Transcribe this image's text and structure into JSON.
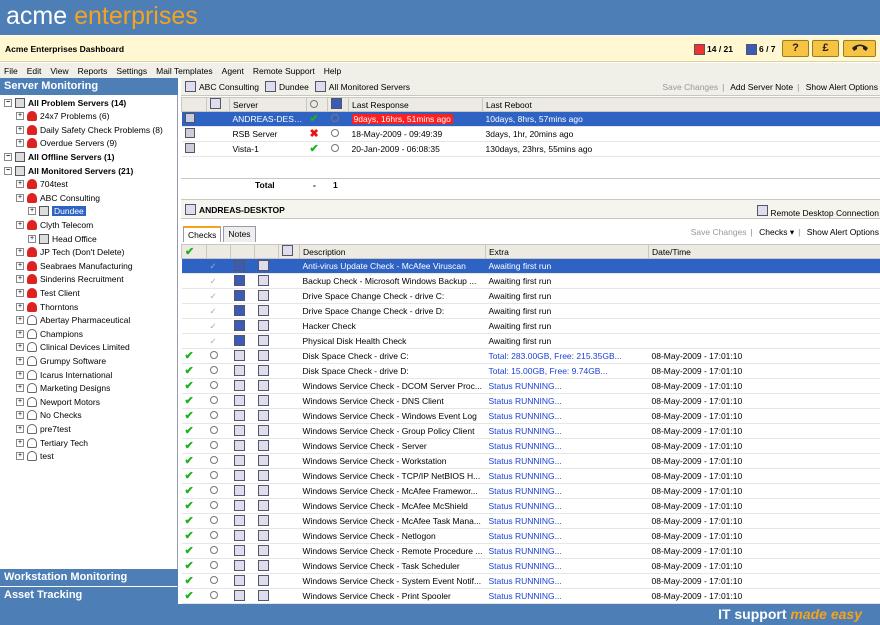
{
  "brand": {
    "part1": "acme",
    "part2": "enterprises"
  },
  "dashboard": {
    "title": "Acme Enterprises Dashboard",
    "counter1": "14 / 21",
    "counter2": "6 / 7",
    "help_label": "?",
    "billing_label": "£"
  },
  "menu": [
    "File",
    "Edit",
    "View",
    "Reports",
    "Settings",
    "Mail Templates",
    "Agent",
    "Remote Support",
    "Help"
  ],
  "left": {
    "server_monitoring": "Server Monitoring",
    "workstation_monitoring": "Workstation Monitoring",
    "asset_tracking": "Asset Tracking",
    "tree": [
      {
        "label": "All Problem Servers (14)",
        "bold": true,
        "indent": 0,
        "icon": "server"
      },
      {
        "label": "24x7 Problems (6)",
        "indent": 1,
        "icon": "alert-person"
      },
      {
        "label": "Daily Safety Check Problems (8)",
        "indent": 1,
        "icon": "alert-person"
      },
      {
        "label": "Overdue Servers (9)",
        "indent": 1,
        "icon": "alert-person"
      },
      {
        "label": "All Offline Servers (1)",
        "bold": true,
        "indent": 0,
        "icon": "server"
      },
      {
        "label": "All Monitored Servers (21)",
        "bold": true,
        "indent": 0,
        "icon": "server"
      },
      {
        "label": "704test",
        "indent": 1,
        "icon": "alert-person"
      },
      {
        "label": "ABC Consulting",
        "indent": 1,
        "icon": "alert-person"
      },
      {
        "label": "Dundee",
        "indent": 2,
        "icon": "server",
        "selected": true
      },
      {
        "label": "Clyth Telecom",
        "indent": 1,
        "icon": "alert-person"
      },
      {
        "label": "Head Office",
        "indent": 2,
        "icon": "server"
      },
      {
        "label": "JP Tech (Don't Delete)",
        "indent": 1,
        "icon": "alert-person"
      },
      {
        "label": "Seabraes Manufacturing",
        "indent": 1,
        "icon": "alert-person"
      },
      {
        "label": "Sinderins Recruitment",
        "indent": 1,
        "icon": "alert-person"
      },
      {
        "label": "Test Client",
        "indent": 1,
        "icon": "alert-person"
      },
      {
        "label": "Thorntons",
        "indent": 1,
        "icon": "alert-person"
      },
      {
        "label": "Abertay Pharmaceutical",
        "indent": 1,
        "icon": "ok-person"
      },
      {
        "label": "Champions",
        "indent": 1,
        "icon": "ok-person"
      },
      {
        "label": "Clinical Devices Limited",
        "indent": 1,
        "icon": "ok-person"
      },
      {
        "label": "Grumpy Software",
        "indent": 1,
        "icon": "ok-person"
      },
      {
        "label": "Icarus International",
        "indent": 1,
        "icon": "ok-person"
      },
      {
        "label": "Marketing Designs",
        "indent": 1,
        "icon": "ok-person"
      },
      {
        "label": "Newport Motors",
        "indent": 1,
        "icon": "ok-person"
      },
      {
        "label": "No Checks",
        "indent": 1,
        "icon": "ok-person"
      },
      {
        "label": "pre7test",
        "indent": 1,
        "icon": "ok-person"
      },
      {
        "label": "Tertiary Tech",
        "indent": 1,
        "icon": "ok-person"
      },
      {
        "label": "test",
        "indent": 1,
        "icon": "ok-person"
      }
    ]
  },
  "crumbs": [
    "ABC Consulting",
    "Dundee",
    "All Monitored Servers"
  ],
  "toplinks": {
    "save": "Save Changes",
    "add_note": "Add Server Note",
    "alert_opts": "Show Alert Options"
  },
  "servers": {
    "headers": [
      "Server",
      "Last Response",
      "Last Reboot"
    ],
    "rows": [
      {
        "server": "ANDREAS-DESK...",
        "status": "ok",
        "last_response": "9days, 16hrs, 51mins ago",
        "last_reboot": "10days, 8hrs, 57mins ago",
        "hot": true,
        "selected": true
      },
      {
        "server": "RSB Server",
        "status": "err",
        "last_response": "18-May-2009 - 09:49:39",
        "last_reboot": "3days, 1hr, 20mins ago"
      },
      {
        "server": "Vista-1",
        "status": "ok",
        "last_response": "20-Jan-2009 - 06:08:35",
        "last_reboot": "130days, 23hrs, 55mins ago"
      }
    ],
    "total_label": "Total",
    "total_dash": "-",
    "total_count": "1"
  },
  "detail": {
    "name": "ANDREAS-DESKTOP",
    "rdc": "Remote Desktop Connection",
    "tabs": [
      "Checks",
      "Notes"
    ],
    "save": "Save Changes",
    "checks_menu": "Checks",
    "alert_opts": "Show Alert Options",
    "headers": [
      "Description",
      "Extra",
      "Date/Time"
    ]
  },
  "checks": [
    {
      "status": "pending",
      "desc": "Anti-virus Update Check - McAfee Viruscan",
      "extra": "Awaiting first run",
      "date": "",
      "selected": true
    },
    {
      "status": "pending",
      "desc": "Backup Check - Microsoft Windows Backup ...",
      "extra": "Awaiting first run",
      "date": ""
    },
    {
      "status": "pending",
      "desc": "Drive Space Change Check - drive C:",
      "extra": "Awaiting first run",
      "date": ""
    },
    {
      "status": "pending",
      "desc": "Drive Space Change Check - drive D:",
      "extra": "Awaiting first run",
      "date": ""
    },
    {
      "status": "pending",
      "desc": "Hacker Check",
      "extra": "Awaiting first run",
      "date": ""
    },
    {
      "status": "pending",
      "desc": "Physical Disk Health Check",
      "extra": "Awaiting first run",
      "date": ""
    },
    {
      "status": "ok",
      "desc": "Disk Space Check - drive C:",
      "extra": "Total: 283.00GB, Free: 215.35GB...",
      "date": "08-May-2009 - 17:01:10",
      "blue": true
    },
    {
      "status": "ok",
      "desc": "Disk Space Check - drive D:",
      "extra": "Total: 15.00GB, Free: 9.74GB...",
      "date": "08-May-2009 - 17:01:10",
      "blue": true
    },
    {
      "status": "ok",
      "desc": "Windows Service Check - DCOM Server Proc...",
      "extra": "Status RUNNING...",
      "date": "08-May-2009 - 17:01:10",
      "blue": true
    },
    {
      "status": "ok",
      "desc": "Windows Service Check - DNS Client",
      "extra": "Status RUNNING...",
      "date": "08-May-2009 - 17:01:10",
      "blue": true
    },
    {
      "status": "ok",
      "desc": "Windows Service Check - Windows Event Log",
      "extra": "Status RUNNING...",
      "date": "08-May-2009 - 17:01:10",
      "blue": true
    },
    {
      "status": "ok",
      "desc": "Windows Service Check - Group Policy Client",
      "extra": "Status RUNNING...",
      "date": "08-May-2009 - 17:01:10",
      "blue": true
    },
    {
      "status": "ok",
      "desc": "Windows Service Check - Server",
      "extra": "Status RUNNING...",
      "date": "08-May-2009 - 17:01:10",
      "blue": true
    },
    {
      "status": "ok",
      "desc": "Windows Service Check - Workstation",
      "extra": "Status RUNNING...",
      "date": "08-May-2009 - 17:01:10",
      "blue": true
    },
    {
      "status": "ok",
      "desc": "Windows Service Check - TCP/IP NetBIOS H...",
      "extra": "Status RUNNING...",
      "date": "08-May-2009 - 17:01:10",
      "blue": true
    },
    {
      "status": "ok",
      "desc": "Windows Service Check - McAfee Framewor...",
      "extra": "Status RUNNING...",
      "date": "08-May-2009 - 17:01:10",
      "blue": true
    },
    {
      "status": "ok",
      "desc": "Windows Service Check - McAfee McShield",
      "extra": "Status RUNNING...",
      "date": "08-May-2009 - 17:01:10",
      "blue": true
    },
    {
      "status": "ok",
      "desc": "Windows Service Check - McAfee Task Mana...",
      "extra": "Status RUNNING...",
      "date": "08-May-2009 - 17:01:10",
      "blue": true
    },
    {
      "status": "ok",
      "desc": "Windows Service Check - Netlogon",
      "extra": "Status RUNNING...",
      "date": "08-May-2009 - 17:01:10",
      "blue": true
    },
    {
      "status": "ok",
      "desc": "Windows Service Check - Remote Procedure ...",
      "extra": "Status RUNNING...",
      "date": "08-May-2009 - 17:01:10",
      "blue": true
    },
    {
      "status": "ok",
      "desc": "Windows Service Check - Task Scheduler",
      "extra": "Status RUNNING...",
      "date": "08-May-2009 - 17:01:10",
      "blue": true
    },
    {
      "status": "ok",
      "desc": "Windows Service Check - System Event Notif...",
      "extra": "Status RUNNING...",
      "date": "08-May-2009 - 17:01:10",
      "blue": true
    },
    {
      "status": "ok",
      "desc": "Windows Service Check - Print Spooler",
      "extra": "Status RUNNING...",
      "date": "08-May-2009 - 17:01:10",
      "blue": true
    }
  ],
  "footer": {
    "part1": "IT support ",
    "part2": "made easy"
  }
}
